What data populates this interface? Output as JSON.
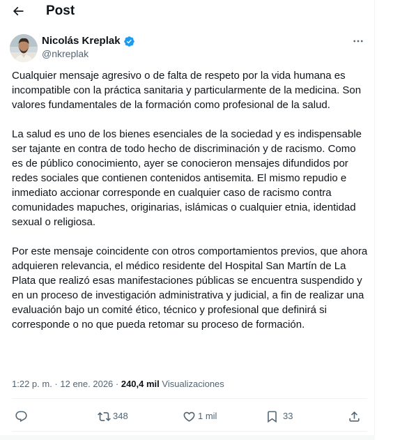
{
  "header": {
    "title": "Post",
    "back_icon": "arrow-left-icon"
  },
  "author": {
    "name": "Nicolás Kreplak",
    "handle": "@nkreplak",
    "verified_icon": "verified-badge-icon",
    "verified_color": "#1d9bf0"
  },
  "post": {
    "paragraphs": [
      "Cualquier mensaje agresivo o de falta de respeto por la vida humana es incompatible con la práctica sanitaria y particularmente de la medicina. Son valores fundamentales de la formación como profesional de la salud.",
      "La salud es uno de los bienes esenciales de la sociedad y es indispensable ser tajante en contra de todo hecho de discriminación y de racismo. Como es de público conocimiento, ayer se conocieron mensajes difundidos por redes sociales que contienen contenidos antisemita. El mismo repudio e inmediato accionar corresponde en cualquier caso de racismo contra comunidades mapuches, originarias, islámicas o cualquier etnia, identidad sexual o religiosa.",
      "Por este mensaje coincidente con otros comportamientos previos, que ahora adquieren relevancia, el médico residente del Hospital San Martín de La Plata que realizó esas manifestaciones públicas se encuentra suspendido y en un proceso de investigación administrativa y judicial, a fin de realizar una evaluación bajo un comité ético, técnico y profesional que definirá si corresponde o no que pueda retomar su proceso de formación."
    ]
  },
  "meta": {
    "time": "1:22 p. m.",
    "separator": " · ",
    "date": "12 ene. 2026",
    "views_count": "240,4 mil",
    "views_label": "Visualizaciones"
  },
  "actions": {
    "reply": {
      "icon": "reply-icon",
      "count": ""
    },
    "repost": {
      "icon": "repost-icon",
      "count": "348"
    },
    "like": {
      "icon": "heart-icon",
      "count": "1 mil"
    },
    "bookmark": {
      "icon": "bookmark-icon",
      "count": "33"
    },
    "share": {
      "icon": "share-icon",
      "count": ""
    }
  },
  "colors": {
    "text_primary": "#0f1419",
    "text_secondary": "#536471",
    "border": "#eff3f4",
    "accent": "#1d9bf0"
  }
}
